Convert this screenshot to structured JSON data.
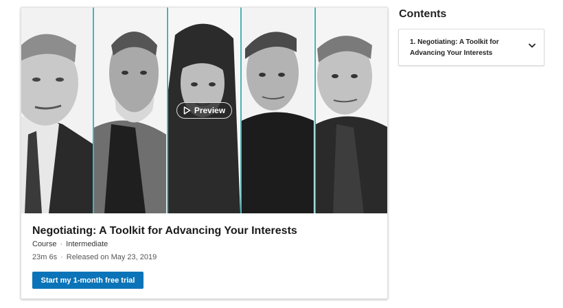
{
  "hero": {
    "preview_label": "Preview",
    "accent_color": "#47b3b6",
    "panels": [
      "instructor-1",
      "instructor-2",
      "instructor-3",
      "instructor-4",
      "instructor-5"
    ]
  },
  "course": {
    "title": "Negotiating: A Toolkit for Advancing Your Interests",
    "type": "Course",
    "level": "Intermediate",
    "duration": "23m 6s",
    "released": "Released on May 23, 2019",
    "cta_label": "Start my 1-month free trial",
    "cta_color": "#0b74b8"
  },
  "contents": {
    "heading": "Contents",
    "items": [
      {
        "label": "1. Negotiating: A Toolkit for Advancing Your Interests",
        "icon": "chevron-down-icon"
      }
    ]
  }
}
